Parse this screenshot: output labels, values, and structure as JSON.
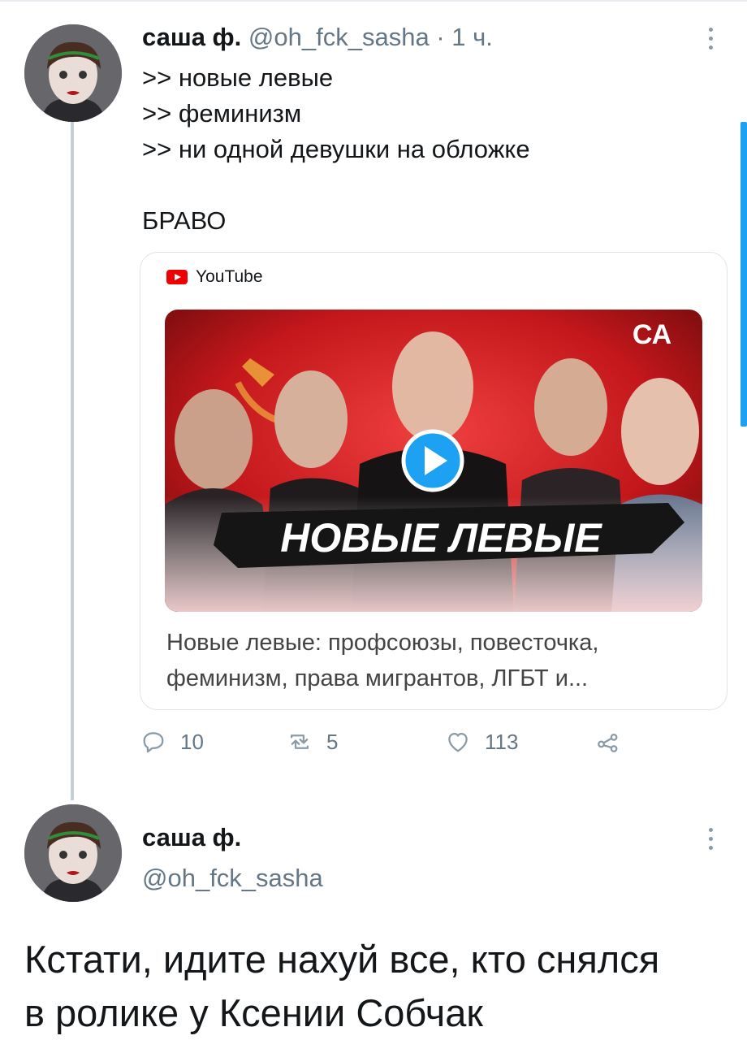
{
  "tweet1": {
    "name": "саша ф.",
    "handle": "@oh_fck_sasha",
    "time": "· 1 ч.",
    "lines": [
      ">> новые левые",
      ">> феминизм",
      ">> ни одной девушки на обложке",
      "",
      "БРАВО"
    ],
    "card": {
      "source": "YouTube",
      "thumbnail_text": "НОВЫЕ ЛЕВЫЕ",
      "channel_mark": "СА",
      "title_line1": "Новые левые: профсоюзы, повесточка,",
      "title_line2": "феминизм, права мигрантов, ЛГБТ и..."
    },
    "actions": {
      "replies": "10",
      "retweets": "5",
      "likes": "113"
    }
  },
  "tweet2": {
    "name": "саша ф.",
    "handle": "@oh_fck_sasha",
    "text_line1": "Кстати, идите нахуй все, кто снялся",
    "text_line2": "в ролике у Ксении Собчак"
  },
  "colors": {
    "accent": "#1da1f2",
    "secondary_text": "#657786",
    "thumbnail_red": "#d21f23"
  },
  "icons": [
    "reply-icon",
    "retweet-icon",
    "like-icon",
    "share-icon",
    "more-icon",
    "youtube-icon",
    "play-icon"
  ]
}
